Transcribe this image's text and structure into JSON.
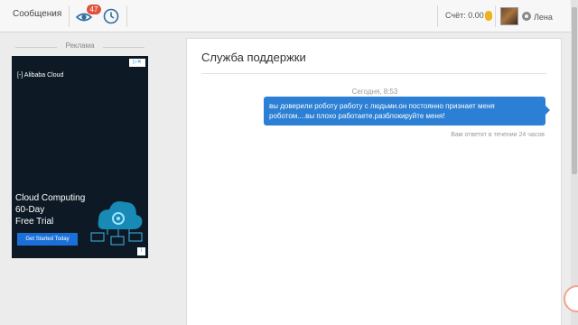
{
  "topbar": {
    "messages_label": "Сообщения",
    "notifications_badge": "47",
    "balance": "Счёт: 0.00",
    "username": "Лена",
    "icons": {
      "views": "eye-icon",
      "history": "clock-icon",
      "currency": "coin-icon",
      "avatar": "avatar",
      "settings": "gear-icon"
    }
  },
  "sidebar": {
    "ad_label": "Реклама",
    "ad": {
      "brand": "Alibaba Cloud",
      "headline": "Cloud Computing\n60-Day\nFree Trial",
      "cta": "Get Started Today"
    }
  },
  "support": {
    "title": "Служба поддержки",
    "message_time": "Сегодня, 8:53",
    "message_text": "вы доверили роботу работу с людьми.он постоянно признает меня роботом....вы плохо работаете.разблокируйте меня!",
    "reply_hint": "Вам ответят в течении 24 часов"
  },
  "colors": {
    "accent": "#2b7fd4",
    "badge": "#e0533d",
    "coin": "#f0b21c"
  }
}
